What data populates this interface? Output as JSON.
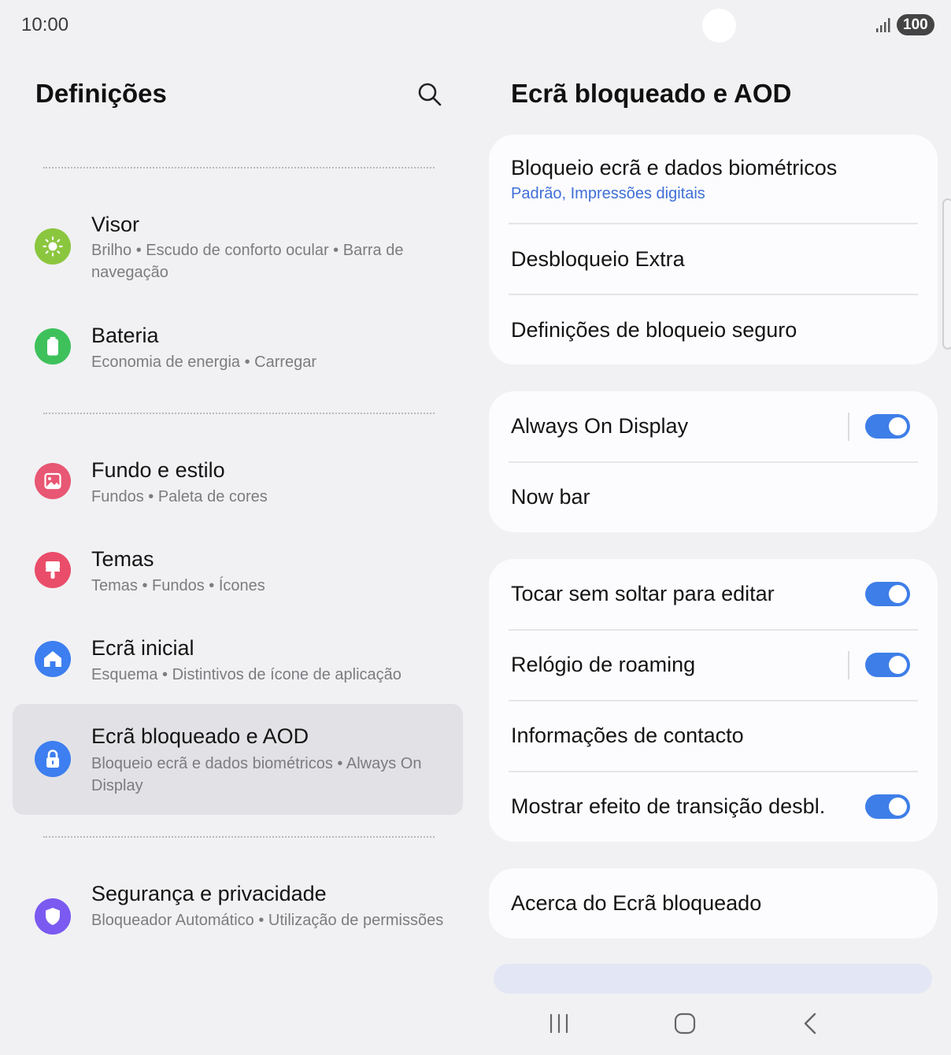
{
  "status_bar": {
    "time": "10:00",
    "battery": "100"
  },
  "left_pane": {
    "title": "Definições",
    "items": [
      {
        "title": "Visor",
        "subtitle": "Brilho  •  Escudo de conforto ocular  •  Barra de navegação",
        "icon": "display-sun-icon",
        "color": "#8bc63f"
      },
      {
        "title": "Bateria",
        "subtitle": "Economia de energia  •  Carregar",
        "icon": "battery-icon",
        "color": "#3ec15b"
      },
      {
        "title": "Fundo e estilo",
        "subtitle": "Fundos  •  Paleta de cores",
        "icon": "wallpaper-icon",
        "color": "#e85773"
      },
      {
        "title": "Temas",
        "subtitle": "Temas  •  Fundos  •  Ícones",
        "icon": "paint-brush-icon",
        "color": "#ea4d6a"
      },
      {
        "title": "Ecrã inicial",
        "subtitle": "Esquema  •  Distintivos de ícone de aplicação",
        "icon": "home-icon",
        "color": "#3d7ef0"
      },
      {
        "title": "Ecrã bloqueado e AOD",
        "subtitle": "Bloqueio ecrã e dados biométricos  •  Always On Display",
        "icon": "lock-icon",
        "color": "#3d7ef0",
        "selected": true
      },
      {
        "title": "Segurança e privacidade",
        "subtitle": "Bloqueador Automático  •  Utilização de permissões",
        "icon": "shield-icon",
        "color": "#7a5af0"
      }
    ]
  },
  "right_pane": {
    "title": "Ecrã bloqueado e AOD",
    "card1": {
      "biometrics_title": "Bloqueio ecrã e dados biométricos",
      "biometrics_sub": "Padrão, Impressões digitais",
      "extra_unlock": "Desbloqueio Extra",
      "secure_lock": "Definições de bloqueio seguro"
    },
    "card2": {
      "aod": "Always On Display",
      "aod_on": true,
      "now_bar": "Now bar"
    },
    "card3": {
      "touch_hold": "Tocar sem soltar para editar",
      "touch_hold_on": true,
      "roaming_clock": "Relógio de roaming",
      "roaming_clock_on": true,
      "contact_info": "Informações de contacto",
      "transition": "Mostrar efeito de transição desbl.",
      "transition_on": true
    },
    "card4": {
      "about": "Acerca do Ecrã bloqueado"
    }
  },
  "accent_color": "#3e7ee8"
}
